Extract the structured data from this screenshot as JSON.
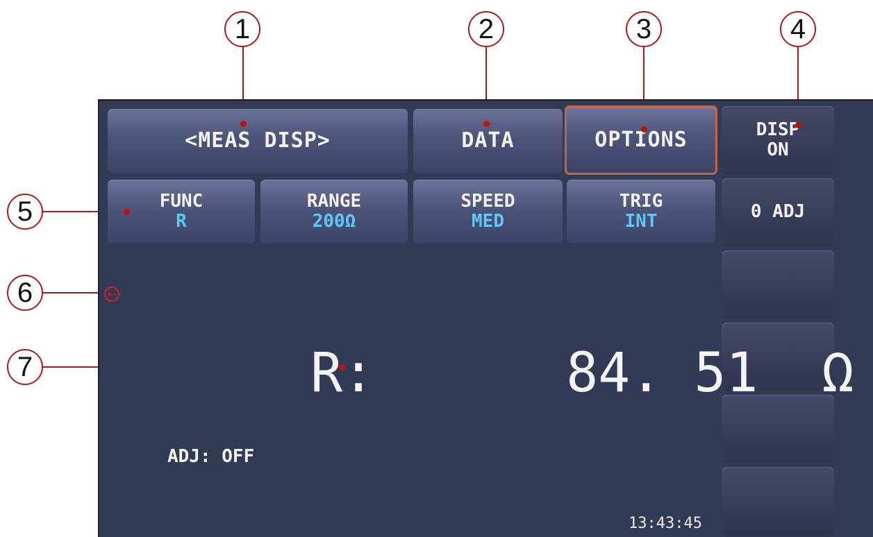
{
  "callouts": [
    "1",
    "2",
    "3",
    "4",
    "5",
    "6",
    "7"
  ],
  "tabs": {
    "meas_disp": "<MEAS DISP>",
    "data": "DATA",
    "options": "OPTIONS"
  },
  "softkeys": {
    "disp_line1": "DISP",
    "disp_line2": "ON",
    "zero_adj": "0 ADJ"
  },
  "params": [
    {
      "label": "FUNC",
      "value": "R"
    },
    {
      "label": "RANGE",
      "value": "200Ω"
    },
    {
      "label": "SPEED",
      "value": "MED"
    },
    {
      "label": "TRIG",
      "value": "INT"
    }
  ],
  "measurement": {
    "label": "R:",
    "value": "84. 51",
    "unit": "Ω"
  },
  "adj_status": "ADJ: OFF",
  "clock": "13:43:45",
  "colors": {
    "screen_bg": "#323b56",
    "param_value": "#5ec8f4",
    "callout": "#b01818",
    "options_highlight": "#c0654a"
  },
  "icons": {
    "trigger_indicator": "circle-arrow-left-icon"
  }
}
